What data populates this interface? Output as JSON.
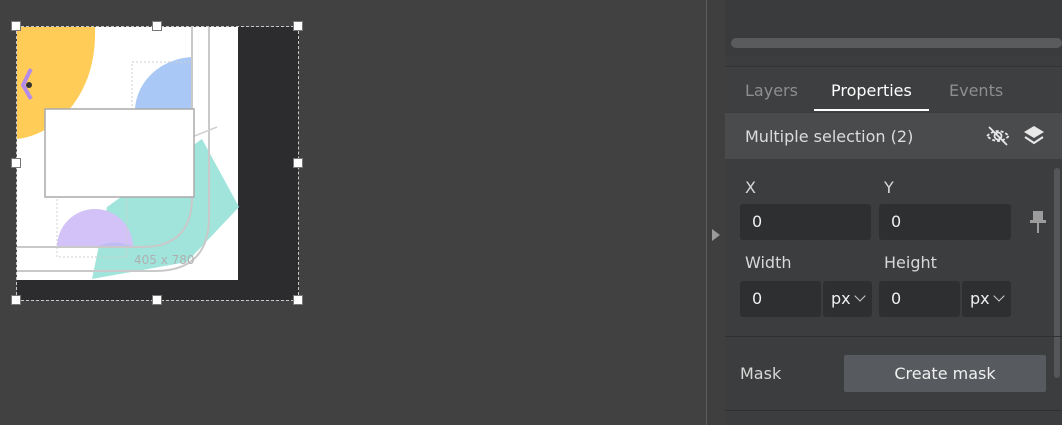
{
  "canvas": {
    "artboard_label": "405 x 780"
  },
  "panel": {
    "tabs": [
      {
        "label": "Layers",
        "active": false
      },
      {
        "label": "Properties",
        "active": true
      },
      {
        "label": "Events",
        "active": false
      }
    ],
    "selection_title": "Multiple selection (2)",
    "icons": {
      "visibility": "eye-off-icon",
      "layers": "layers-icon",
      "pin": "pin-icon"
    },
    "fields": {
      "x_label": "X",
      "x_value": "0",
      "y_label": "Y",
      "y_value": "0",
      "width_label": "Width",
      "width_value": "0",
      "width_unit": "px",
      "height_label": "Height",
      "height_value": "0",
      "height_unit": "px"
    },
    "mask": {
      "label": "Mask",
      "button_label": "Create mask"
    }
  },
  "colors": {
    "canvas_bg": "#414141",
    "panel_bg": "#3c3d3e",
    "accent_yellow": "#ffcd57",
    "accent_blue": "#a9c8f5",
    "accent_teal": "#9be3d9",
    "accent_purple": "#d2c2f7"
  }
}
